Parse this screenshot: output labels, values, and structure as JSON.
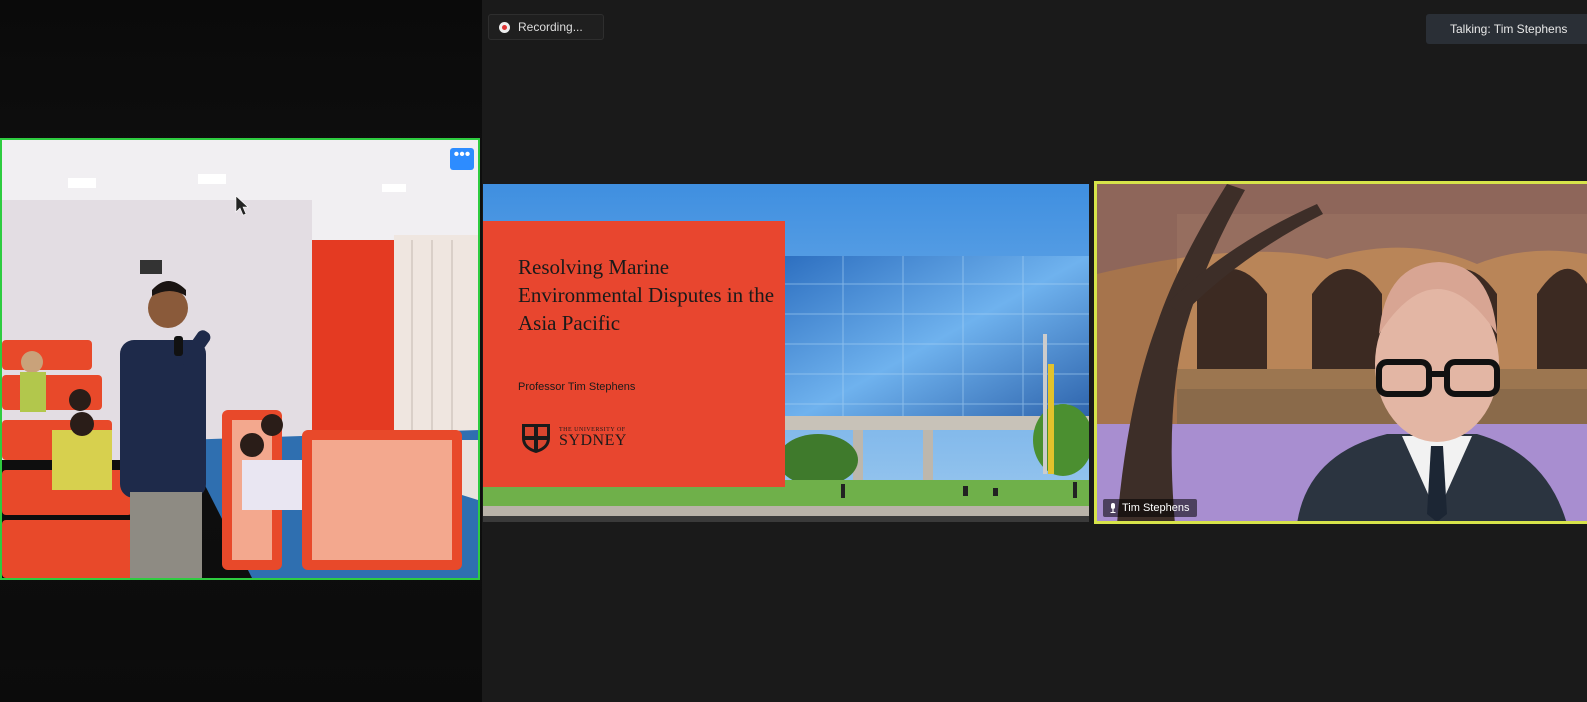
{
  "meeting": {
    "recording_label": "Recording...",
    "talking_label": "Talking: Tim Stephens"
  },
  "slide": {
    "title": "Resolving Marine Environmental Disputes in the Asia Pacific",
    "presenter": "Professor Tim Stephens",
    "logo_small": "THE UNIVERSITY OF",
    "logo_big": "SYDNEY"
  },
  "speaker": {
    "name": "Tim Stephens"
  },
  "room_tile": {
    "more_label": "•••"
  },
  "colors": {
    "active_speaker_border": "#d7e44a",
    "room_border": "#2ecc40",
    "slide_bg": "#e8462f",
    "accent_button": "#2d8cff"
  }
}
